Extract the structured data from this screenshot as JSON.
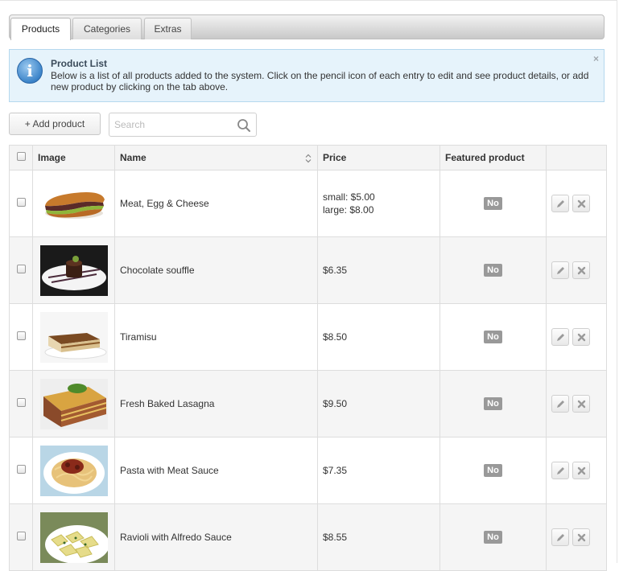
{
  "tabs": [
    {
      "label": "Products",
      "active": true
    },
    {
      "label": "Categories",
      "active": false
    },
    {
      "label": "Extras",
      "active": false
    }
  ],
  "info": {
    "title": "Product List",
    "text": "Below is a list of all products added to the system. Click on the pencil icon of each entry to edit and see product details, or add new product by clicking on the tab above.",
    "close": "×",
    "icon": "info-icon"
  },
  "toolbar": {
    "add_label": "+ Add product",
    "search_placeholder": "Search",
    "search_value": ""
  },
  "table": {
    "columns": [
      "Image",
      "Name",
      "Price",
      "Featured product"
    ],
    "rows": [
      {
        "name": "Meat, Egg & Cheese",
        "price": [
          "small: $5.00",
          "large: $8.00"
        ],
        "featured": "No",
        "image": "sandwich"
      },
      {
        "name": "Chocolate souffle",
        "price": [
          "$6.35"
        ],
        "featured": "No",
        "image": "chocolate-souffle"
      },
      {
        "name": "Tiramisu",
        "price": [
          "$8.50"
        ],
        "featured": "No",
        "image": "tiramisu"
      },
      {
        "name": "Fresh Baked Lasagna",
        "price": [
          "$9.50"
        ],
        "featured": "No",
        "image": "lasagna"
      },
      {
        "name": "Pasta with Meat Sauce",
        "price": [
          "$7.35"
        ],
        "featured": "No",
        "image": "pasta"
      },
      {
        "name": "Ravioli with Alfredo Sauce",
        "price": [
          "$8.55"
        ],
        "featured": "No",
        "image": "ravioli"
      }
    ]
  },
  "colors": {
    "info_bg": "#e6f3fb",
    "info_border": "#b5d8ee",
    "badge_bg": "#999999"
  }
}
